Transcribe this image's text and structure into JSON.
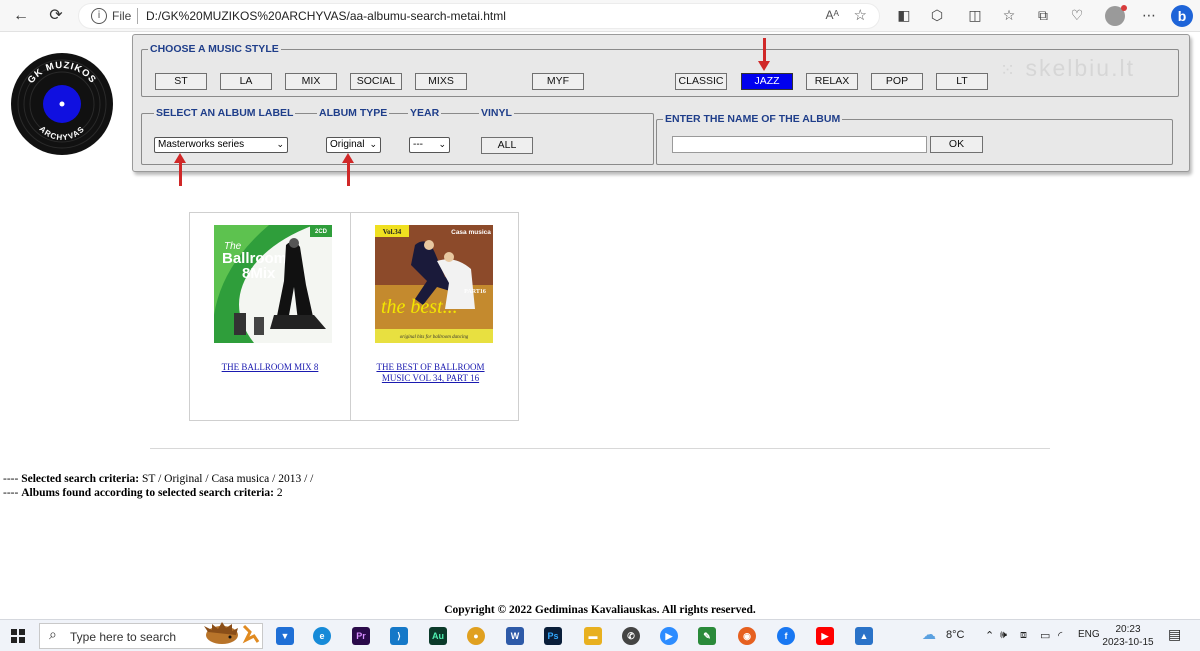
{
  "browser": {
    "file_label": "File",
    "url": "D:/GK%20MUZIKOS%20ARCHYVAS/aa-albumu-search-metai.html",
    "aa_label": "Aᴬ"
  },
  "logo": {
    "top_text": "GK MUZIKOS",
    "bottom_text": "ARCHYVAS"
  },
  "style_section": {
    "legend": "CHOOSE A MUSIC STYLE",
    "buttons": [
      "ST",
      "LA",
      "MIX",
      "SOCIAL",
      "MIXS",
      "MYF",
      "CLASSIC",
      "JAZZ",
      "RELAX",
      "POP",
      "LT"
    ],
    "active": "JAZZ",
    "active_color": "#0000ee"
  },
  "watermark": "skelbiu.lt",
  "album_section": {
    "label_title": "SELECT AN ALBUM LABEL",
    "label_value": "Masterworks series",
    "type_title": "ALBUM TYPE",
    "type_value": "Original",
    "year_title": "YEAR",
    "year_value": "---",
    "vinyl_title": "VINYL",
    "vinyl_button": "ALL"
  },
  "name_section": {
    "legend": "ENTER THE NAME OF THE ALBUM",
    "input_value": "",
    "ok_label": "OK"
  },
  "annotation_color": "#d02828",
  "albums": [
    {
      "title": "THE BALLROOM MIX 8",
      "cover_text_1": "The",
      "cover_text_2": "Ballroom",
      "cover_text_3": "8Mix",
      "cover_badge": "2CD"
    },
    {
      "title_line1": "THE BEST OF BALLROOM",
      "title_line2": "MUSIC VOL 34, PART 16",
      "cover_vol": "Vol.34",
      "cover_brand": "Casa musica",
      "cover_part": "PART16",
      "cover_script": "the best...",
      "cover_sub": "original hits for ballroom dancing"
    }
  ],
  "criteria": {
    "prefix": "---- ",
    "selected_label": "Selected search criteria:",
    "selected_value": " ST / Original / Casa musica / 2013 / /",
    "found_label": "Albums found according to selected search criteria:",
    "found_value": " 2"
  },
  "copyright": "Copyright © 2022 Gediminas Kavaliauskas. All rights reserved.",
  "taskbar": {
    "search_placeholder": "Type here to search",
    "temperature": "8°C",
    "language": "ENG",
    "time": "20:23",
    "date": "2023-10-15"
  }
}
